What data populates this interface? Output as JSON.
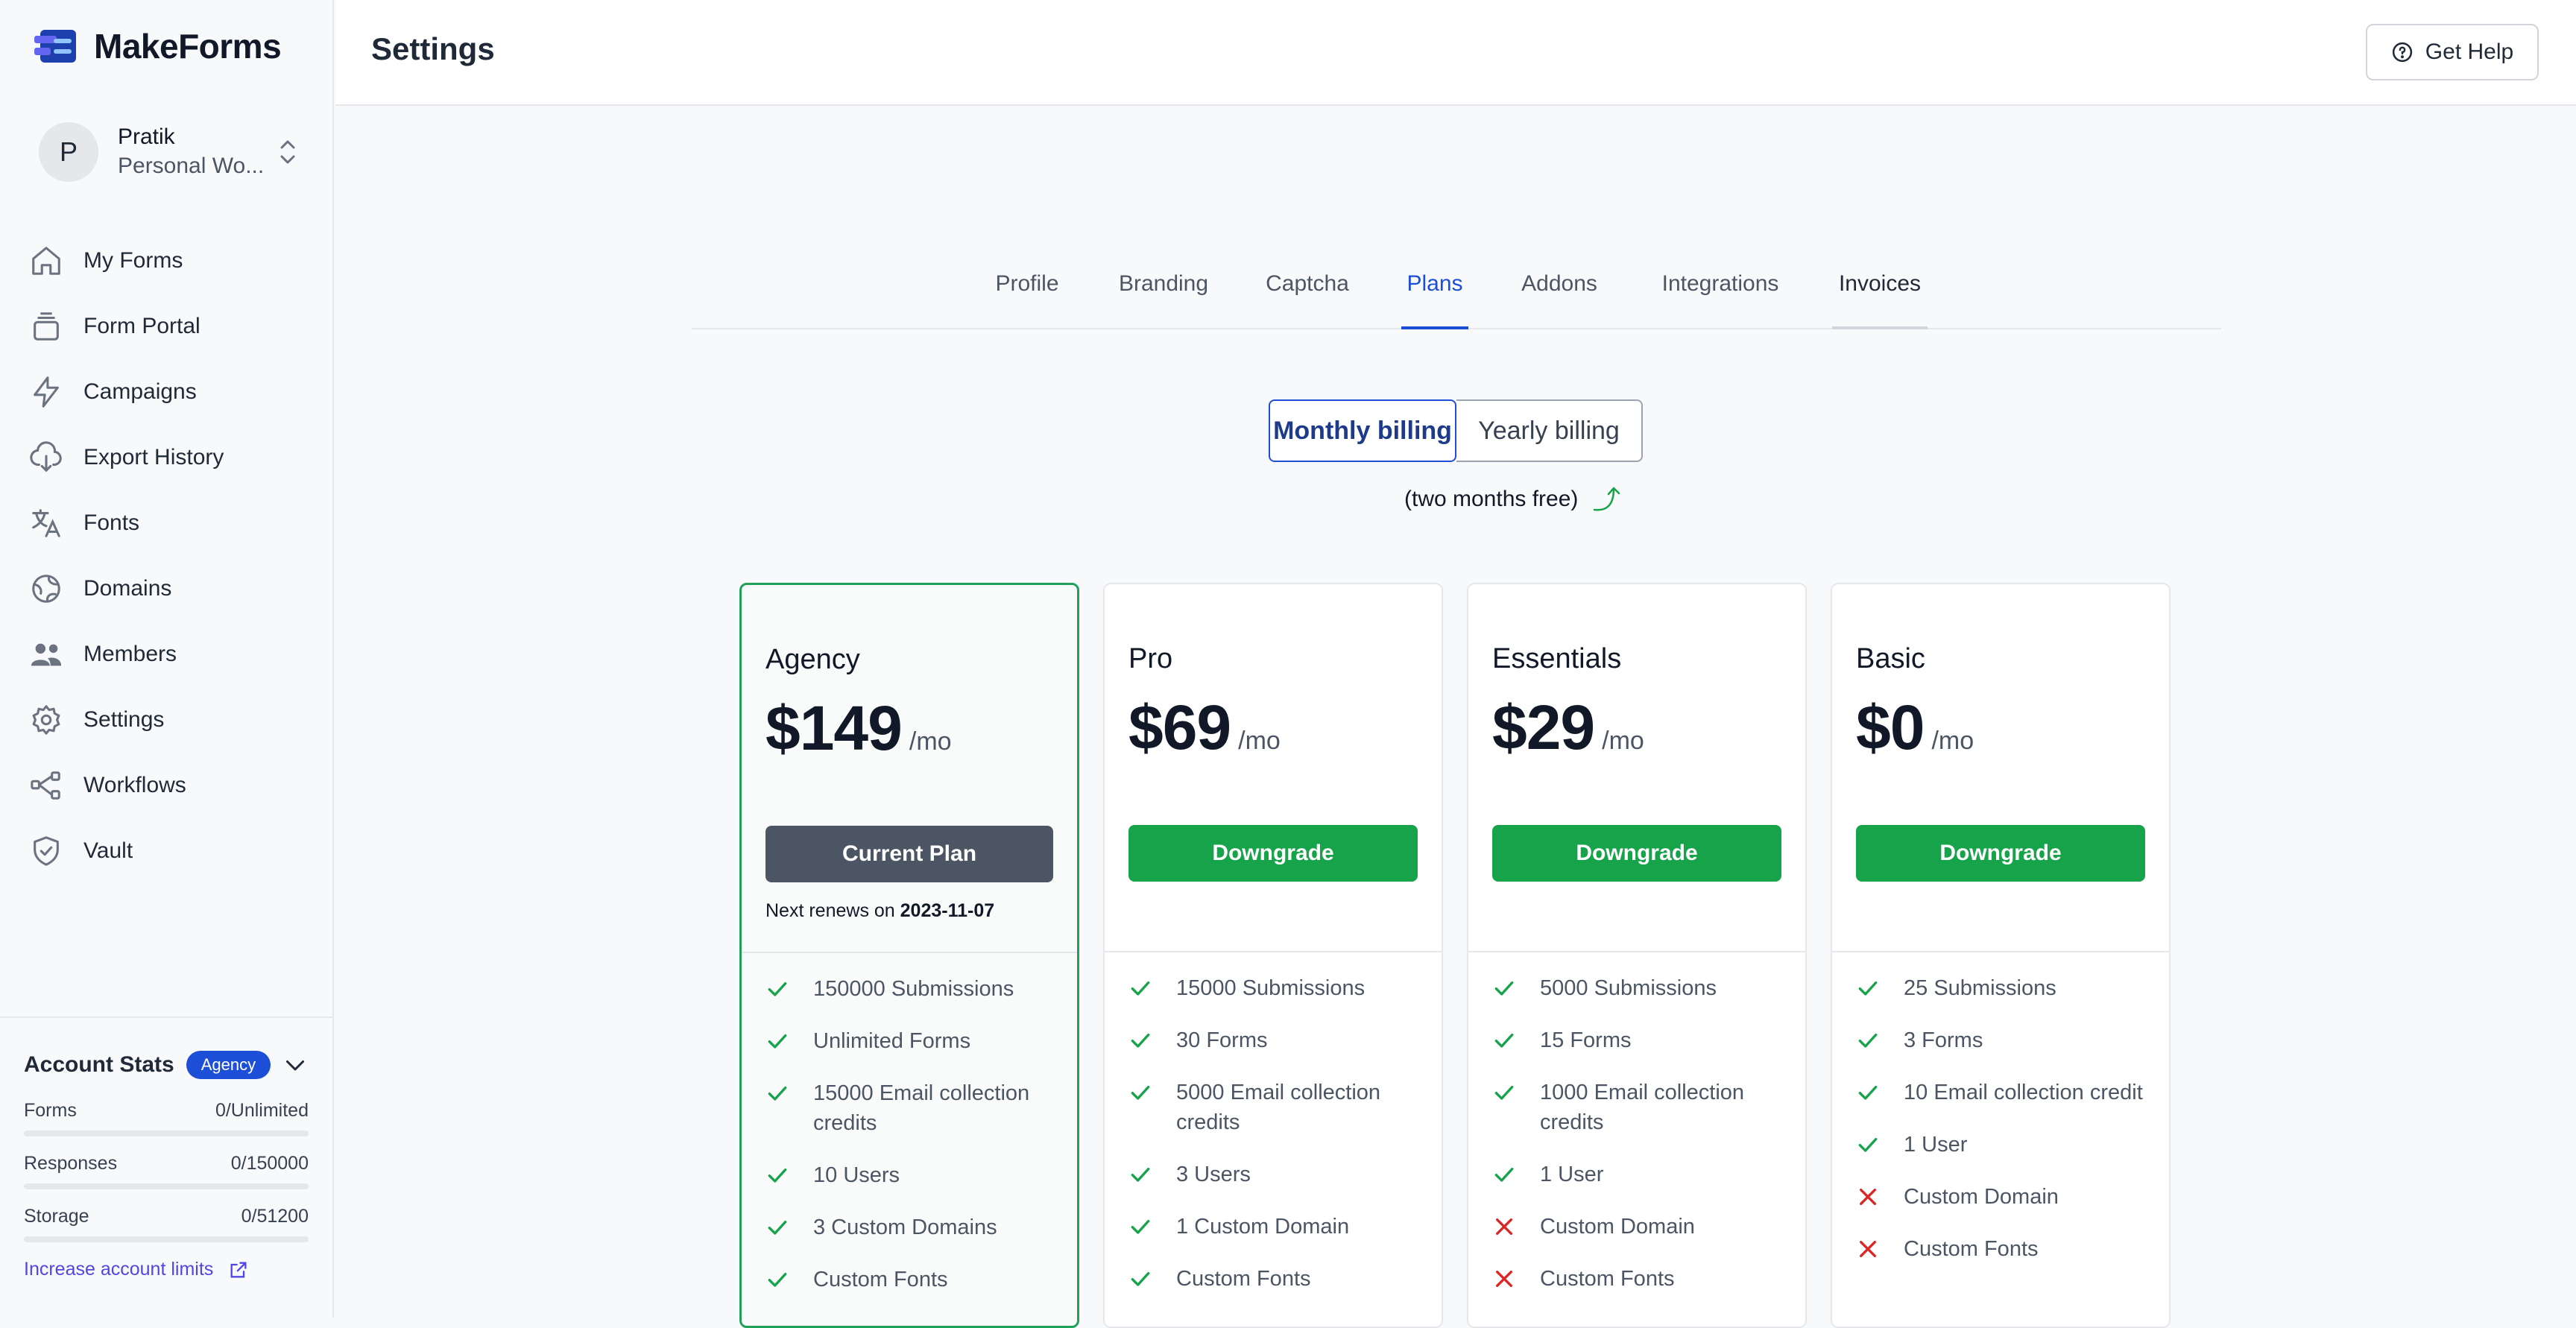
{
  "brand": {
    "name": "MakeForms"
  },
  "workspace": {
    "initial": "P",
    "name": "Pratik",
    "subtitle": "Personal Wo..."
  },
  "sidebar": {
    "items": [
      {
        "label": "My Forms",
        "icon": "home-icon"
      },
      {
        "label": "Form Portal",
        "icon": "stack-icon"
      },
      {
        "label": "Campaigns",
        "icon": "lightning-icon"
      },
      {
        "label": "Export History",
        "icon": "cloud-download-icon"
      },
      {
        "label": "Fonts",
        "icon": "translate-icon"
      },
      {
        "label": "Domains",
        "icon": "globe-icon"
      },
      {
        "label": "Members",
        "icon": "users-icon"
      },
      {
        "label": "Settings",
        "icon": "gear-icon"
      },
      {
        "label": "Workflows",
        "icon": "workflow-icon"
      },
      {
        "label": "Vault",
        "icon": "shield-icon"
      }
    ]
  },
  "account_stats": {
    "title": "Account Stats",
    "badge": "Agency",
    "rows": [
      {
        "label": "Forms",
        "value": "0/Unlimited",
        "fill": 0
      },
      {
        "label": "Responses",
        "value": "0/150000",
        "fill": 0
      },
      {
        "label": "Storage",
        "value": "0/51200",
        "fill": 0
      }
    ],
    "link": "Increase account limits"
  },
  "header": {
    "title": "Settings",
    "help_label": "Get Help"
  },
  "tabs": [
    "Profile",
    "Branding",
    "Captcha",
    "Plans",
    "Addons",
    "Integrations",
    "Invoices"
  ],
  "active_tab": "Plans",
  "billing": {
    "monthly": "Monthly billing",
    "yearly": "Yearly billing",
    "note": "(two months free)"
  },
  "colors": {
    "accent": "#1d4ed8",
    "green": "#16a34a",
    "red": "#dc2626",
    "current_btn": "#4b5563"
  },
  "plans": [
    {
      "name": "Agency",
      "price": "$149",
      "per": "/mo",
      "button": "Current Plan",
      "renews_prefix": "Next renews on ",
      "renews_date": "2023-11-07",
      "features": [
        {
          "text": "150000 Submissions",
          "included": true
        },
        {
          "text": "Unlimited Forms",
          "included": true
        },
        {
          "text": "15000 Email collection credits",
          "included": true
        },
        {
          "text": "10 Users",
          "included": true
        },
        {
          "text": "3 Custom Domains",
          "included": true
        },
        {
          "text": "Custom Fonts",
          "included": true
        }
      ]
    },
    {
      "name": "Pro",
      "price": "$69",
      "per": "/mo",
      "button": "Downgrade",
      "features": [
        {
          "text": "15000 Submissions",
          "included": true
        },
        {
          "text": "30 Forms",
          "included": true
        },
        {
          "text": "5000 Email collection credits",
          "included": true
        },
        {
          "text": "3 Users",
          "included": true
        },
        {
          "text": "1 Custom Domain",
          "included": true
        },
        {
          "text": "Custom Fonts",
          "included": true
        }
      ]
    },
    {
      "name": "Essentials",
      "price": "$29",
      "per": "/mo",
      "button": "Downgrade",
      "features": [
        {
          "text": "5000 Submissions",
          "included": true
        },
        {
          "text": "15 Forms",
          "included": true
        },
        {
          "text": "1000 Email collection credits",
          "included": true
        },
        {
          "text": "1 User",
          "included": true
        },
        {
          "text": "Custom Domain",
          "included": false
        },
        {
          "text": "Custom Fonts",
          "included": false
        }
      ]
    },
    {
      "name": "Basic",
      "price": "$0",
      "per": "/mo",
      "button": "Downgrade",
      "features": [
        {
          "text": "25 Submissions",
          "included": true
        },
        {
          "text": "3 Forms",
          "included": true
        },
        {
          "text": "10 Email collection credit",
          "included": true
        },
        {
          "text": "1 User",
          "included": true
        },
        {
          "text": "Custom Domain",
          "included": false
        },
        {
          "text": "Custom Fonts",
          "included": false
        }
      ]
    }
  ]
}
